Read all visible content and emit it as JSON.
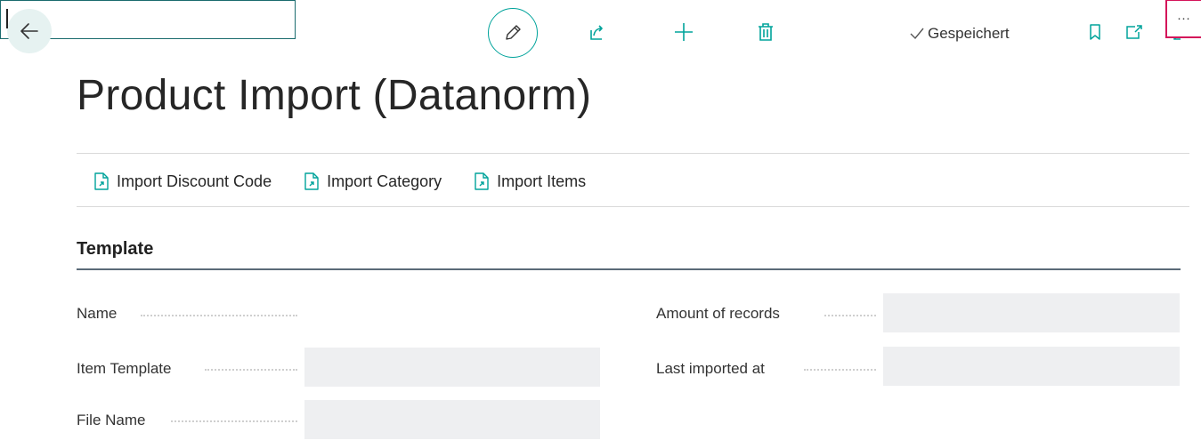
{
  "header": {
    "saved_status": "Gespeichert",
    "page_title": "Product Import (Datanorm)"
  },
  "icons": {
    "back": "arrow-left-icon",
    "edit": "pencil-icon",
    "share": "share-icon",
    "new": "plus-icon",
    "delete": "trash-icon",
    "saved": "check-icon",
    "bookmark": "bookmark-icon",
    "open_new_window": "open-in-new-window-icon",
    "expand": "expand-icon",
    "action": "document-import-icon"
  },
  "actions": [
    {
      "label": "Import Discount Code"
    },
    {
      "label": "Import Category"
    },
    {
      "label": "Import Items"
    }
  ],
  "section": {
    "heading": "Template"
  },
  "fields": {
    "name": {
      "label": "Name",
      "value": "",
      "lookup_label": "···"
    },
    "item_template": {
      "label": "Item Template",
      "value": ""
    },
    "file_name": {
      "label": "File Name",
      "value": ""
    },
    "amount_of_records": {
      "label": "Amount of records",
      "value": ""
    },
    "last_imported_at": {
      "label": "Last imported at",
      "value": ""
    }
  },
  "colors": {
    "accent": "#00a39b",
    "focus_border": "#1a6b6e",
    "lookup_highlight": "#d4145a",
    "field_background": "#eeeff1"
  }
}
